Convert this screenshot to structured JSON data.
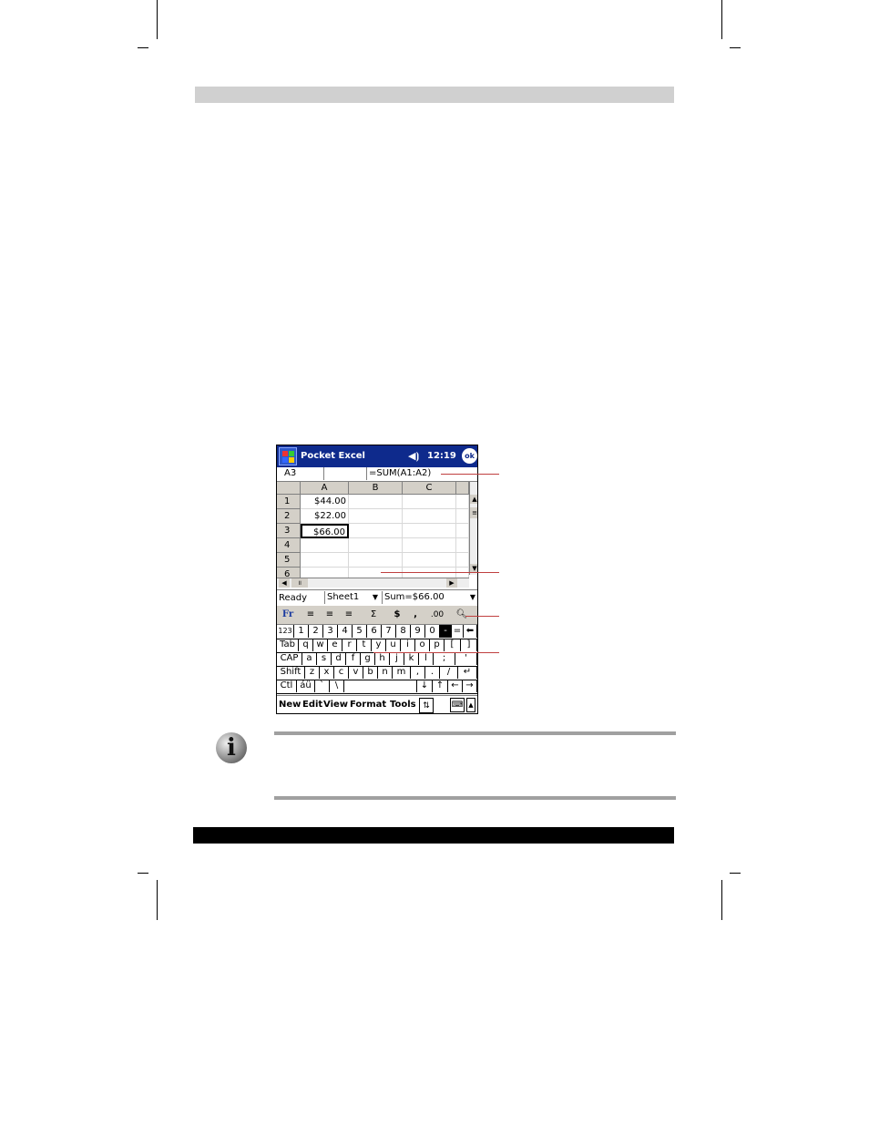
{
  "titlebar": {
    "app_title": "Pocket Excel",
    "speaker_icon": "speaker-icon",
    "clock": "12:19",
    "ok_label": "ok"
  },
  "formula_bar": {
    "cell_ref": "A3",
    "formula": "=SUM(A1:A2)"
  },
  "grid": {
    "columns": [
      "A",
      "B",
      "C"
    ],
    "rows": [
      "1",
      "2",
      "3",
      "4",
      "5",
      "6"
    ],
    "cells": [
      "$44.00",
      "$22.00",
      "$66.00"
    ]
  },
  "status": {
    "ready": "Ready",
    "sheet": "Sheet1",
    "sum": "Sum=$66.00"
  },
  "toolbar": {
    "font_btn": "Fr",
    "autosum": "Σ",
    "currency": "$",
    "comma": ",",
    "decimal": ".00"
  },
  "keyboard": {
    "row1": [
      "123",
      "1",
      "2",
      "3",
      "4",
      "5",
      "6",
      "7",
      "8",
      "9",
      "0",
      "-",
      "=",
      "⬅"
    ],
    "row2": [
      "Tab",
      "q",
      "w",
      "e",
      "r",
      "t",
      "y",
      "u",
      "i",
      "o",
      "p",
      "[",
      "]"
    ],
    "row3": [
      "CAP",
      "a",
      "s",
      "d",
      "f",
      "g",
      "h",
      "j",
      "k",
      "l",
      ";",
      "'"
    ],
    "row4": [
      "Shift",
      "z",
      "x",
      "c",
      "v",
      "b",
      "n",
      "m",
      ",",
      ".",
      "/",
      "↵"
    ],
    "row5": [
      "Ctl",
      "áü",
      "`",
      "\\",
      "",
      "↓",
      "↑",
      "←",
      "→"
    ]
  },
  "menubar": {
    "items": [
      "New",
      "Edit",
      "View",
      "Format",
      "Tools"
    ]
  },
  "colors": {
    "titlebar": "#0e2a8c",
    "callout": "#c04040",
    "rule": "#a0a0a0"
  }
}
